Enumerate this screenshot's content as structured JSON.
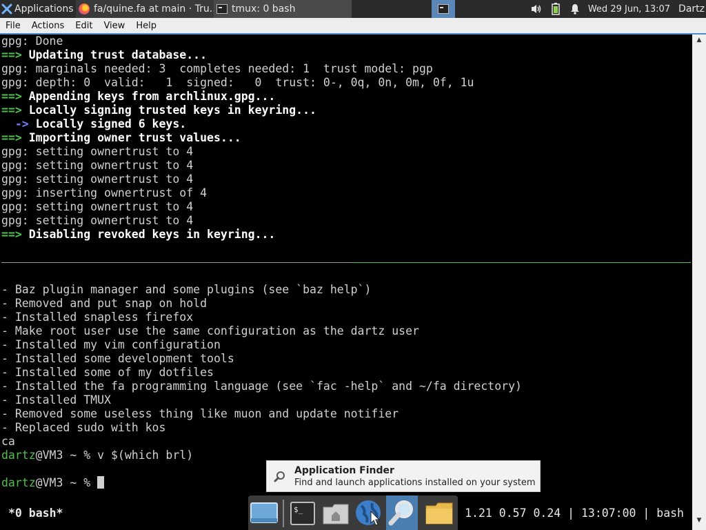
{
  "top_panel": {
    "applications_label": "Applications",
    "tasks": [
      {
        "title": "fa/quine.fa at main · Tru..."
      },
      {
        "title": "tmux: 0 bash"
      }
    ],
    "clock": "Wed 29 Jun, 13:07",
    "user": "Dartz",
    "icons": [
      "xfce-icon",
      "firefox-icon",
      "terminal-icon",
      "volume-icon",
      "battery-icon",
      "notification-bell-icon"
    ]
  },
  "menubar": {
    "items": [
      "File",
      "Actions",
      "Edit",
      "View",
      "Help"
    ]
  },
  "terminal": {
    "top_pane": [
      {
        "prefix": "",
        "text": "gpg: Done"
      },
      {
        "prefix": "==>",
        "text": " Updating trust database..."
      },
      {
        "prefix": "",
        "text": "gpg: marginals needed: 3  completes needed: 1  trust model: pgp"
      },
      {
        "prefix": "",
        "text": "gpg: depth: 0  valid:   1  signed:   0  trust: 0-, 0q, 0n, 0m, 0f, 1u"
      },
      {
        "prefix": "==>",
        "text": " Appending keys from archlinux.gpg..."
      },
      {
        "prefix": "==>",
        "text": " Locally signing trusted keys in keyring..."
      },
      {
        "prefix": "  ->",
        "text": " Locally signed 6 keys."
      },
      {
        "prefix": "==>",
        "text": " Importing owner trust values..."
      },
      {
        "prefix": "",
        "text": "gpg: setting ownertrust to 4"
      },
      {
        "prefix": "",
        "text": "gpg: setting ownertrust to 4"
      },
      {
        "prefix": "",
        "text": "gpg: setting ownertrust to 4"
      },
      {
        "prefix": "",
        "text": "gpg: inserting ownertrust of 4"
      },
      {
        "prefix": "",
        "text": "gpg: setting ownertrust to 4"
      },
      {
        "prefix": "",
        "text": "gpg: setting ownertrust to 4"
      },
      {
        "prefix": "==>",
        "text": " Disabling revoked keys in keyring..."
      }
    ],
    "bottom_pane": [
      "- Baz plugin manager and some plugins (see `baz help`)",
      "- Removed and put snap on hold",
      "- Installed snapless firefox",
      "- Make root user use the same configuration as the dartz user",
      "- Installed my vim configuration",
      "- Installed some development tools",
      "- Installed some of my dotfiles",
      "- Installed the fa programming language (see `fac -help` and ~/fa directory)",
      "- Installed TMUX",
      "- Removed some useless thing like muon and update notifier",
      "- Replaced sudo with kos",
      "ca"
    ],
    "prompt_user": "dartz",
    "prompt_host": "@VM3 ~ % ",
    "last_command": "v $(which brl)",
    "current_input": ""
  },
  "tmux_status": {
    "window": "*0 bash*",
    "right": "1.21 0.57 0.24 | 13:07:00 | bash"
  },
  "tooltip": {
    "title": "Application Finder",
    "description": "Find and launch applications installed on your system"
  },
  "dock": {
    "items": [
      "show-desktop",
      "terminal",
      "home-folder",
      "web-browser",
      "application-finder",
      "file-manager"
    ]
  },
  "colors": {
    "prompt_green": "#4ec24e",
    "arrow_blue": "#6f7fff",
    "terminal_bg": "#000000",
    "panel_bg": "#2b2b2b",
    "active_accent": "#5a86b8"
  }
}
